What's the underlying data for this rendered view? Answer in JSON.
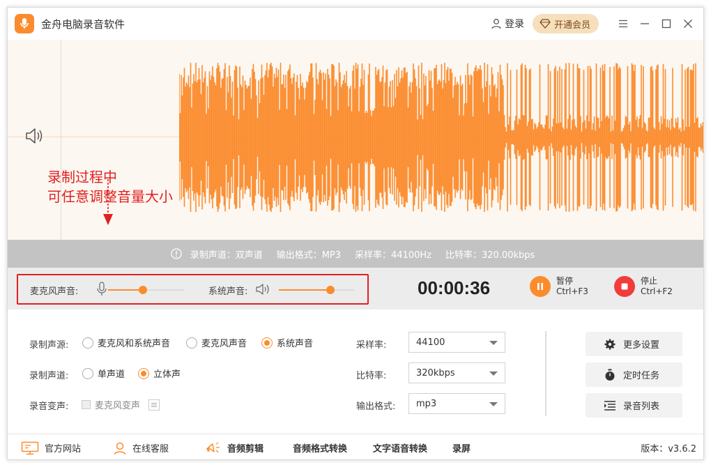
{
  "app": {
    "title": "金舟电脑录音软件",
    "login_label": "登录",
    "vip_label": "开通会员",
    "accent_color": "#fb8c2e"
  },
  "annotation": {
    "line1": "录制过程中",
    "line2": "可任意调整音量大小"
  },
  "info_bar": {
    "channel": "录制声道：双声道",
    "format": "输出格式：MP3",
    "sample_rate": "采样率：44100Hz",
    "bitrate": "比特率：320.00kbps"
  },
  "controls": {
    "mic_label": "麦克风声音:",
    "system_label": "系统声音:",
    "mic_volume_percent": 46,
    "system_volume_percent": 68,
    "timer": "00:00:36",
    "pause_label": "暂停",
    "pause_shortcut": "Ctrl+F3",
    "stop_label": "停止",
    "stop_shortcut": "Ctrl+F2"
  },
  "settings": {
    "source_label": "录制声源:",
    "source_options": [
      "麦克风和系统声音",
      "麦克风声音",
      "系统声音"
    ],
    "source_selected": "系统声音",
    "channel_label": "录制声道:",
    "channel_options": [
      "单声道",
      "立体声"
    ],
    "channel_selected": "立体声",
    "voice_change_label": "录音变声:",
    "voice_change_option": "麦克风变声",
    "sample_rate_label": "采样率:",
    "sample_rate_value": "44100",
    "bitrate_label": "比特率:",
    "bitrate_value": "320kbps",
    "format_label": "输出格式:",
    "format_value": "mp3",
    "more_settings": "更多设置",
    "scheduled_task": "定时任务",
    "recording_list": "录音列表"
  },
  "footer": {
    "website": "官方网站",
    "support": "在线客服",
    "audio_edit": "音频剪辑",
    "format_convert": "音频格式转换",
    "tts": "文字语音转换",
    "screen_record": "录屏",
    "version": "版本：v3.6.2"
  }
}
